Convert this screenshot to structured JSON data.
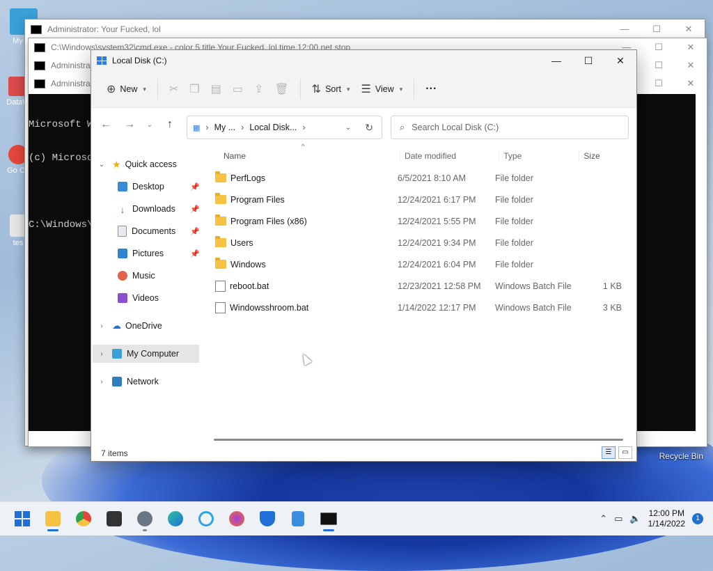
{
  "desktop": {
    "icons": [
      {
        "label": "My Co",
        "color": "#3aa0d8"
      },
      {
        "label": "DataW",
        "color": "#d94a4a"
      },
      {
        "label": "Go Ch",
        "color": "#e3463a"
      },
      {
        "label": "tes",
        "color": "#d0d0d0"
      }
    ],
    "recycle_bin": "Recycle Bin"
  },
  "cmd_windows": [
    {
      "title": "Administrator:  Your Fucked, lol"
    },
    {
      "title": "C:\\Windows\\system32\\cmd.exe - color  5 title Your Fucked, lol time 12:00 net stop"
    },
    {
      "title": "Administrat"
    },
    {
      "title": "Administrat"
    }
  ],
  "cmd_console": {
    "line1": "Microsoft Wi",
    "line2": "(c) Microso",
    "line3": "C:\\Windows\\s"
  },
  "explorer": {
    "title": "Local Disk (C:)",
    "toolbar": {
      "new": "New",
      "sort": "Sort",
      "view": "View",
      "more": "···"
    },
    "address": {
      "crumb1": "My ...",
      "crumb2": "Local Disk..."
    },
    "search": {
      "placeholder": "Search Local Disk (C:)"
    },
    "sidebar": {
      "quick_access": "Quick access",
      "desktop": "Desktop",
      "downloads": "Downloads",
      "documents": "Documents",
      "pictures": "Pictures",
      "music": "Music",
      "videos": "Videos",
      "onedrive": "OneDrive",
      "my_computer": "My Computer",
      "network": "Network"
    },
    "columns": {
      "name": "Name",
      "date": "Date modified",
      "type": "Type",
      "size": "Size"
    },
    "files": [
      {
        "name": "PerfLogs",
        "date": "6/5/2021 8:10 AM",
        "type": "File folder",
        "size": ""
      },
      {
        "name": "Program Files",
        "date": "12/24/2021 6:17 PM",
        "type": "File folder",
        "size": ""
      },
      {
        "name": "Program Files (x86)",
        "date": "12/24/2021 5:55 PM",
        "type": "File folder",
        "size": ""
      },
      {
        "name": "Users",
        "date": "12/24/2021 9:34 PM",
        "type": "File folder",
        "size": ""
      },
      {
        "name": "Windows",
        "date": "12/24/2021 6:04 PM",
        "type": "File folder",
        "size": ""
      },
      {
        "name": "reboot.bat",
        "date": "12/23/2021 12:58 PM",
        "type": "Windows Batch File",
        "size": "1 KB"
      },
      {
        "name": "Windowsshroom.bat",
        "date": "1/14/2022 12:17 PM",
        "type": "Windows Batch File",
        "size": "3 KB"
      }
    ],
    "status": "7 items"
  },
  "taskbar": {
    "clock_time": "12:00 PM",
    "clock_date": "1/14/2022",
    "notifications": "1",
    "colors": {
      "accent": "#1f6fd6"
    }
  }
}
